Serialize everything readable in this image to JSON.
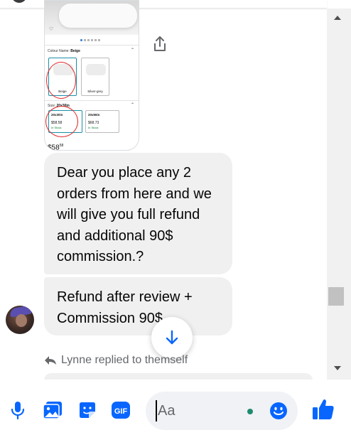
{
  "product_card": {
    "colour_label": "Colour Name:",
    "colour_value": "Beige",
    "swatches": [
      "Beige",
      "Silver-grey"
    ],
    "size_label": "Size:",
    "size_value": "20x30in",
    "sizes": [
      {
        "name": "20x30in",
        "price": "$58.58",
        "stock": "In Stock"
      },
      {
        "name": "20x56in",
        "price": "$68.73",
        "stock": "In Stock"
      }
    ],
    "big_price": "$58",
    "big_price_cents": "58"
  },
  "messages": [
    {
      "text": "Dear you place any 2 orders from here and we will give you full refund and additional 90$ commission.?"
    },
    {
      "text": "Refund after review + Commission 90$"
    }
  ],
  "reply_note": "Lynne replied to themself",
  "composer": {
    "placeholder": "Aa"
  },
  "colors": {
    "accent": "#0866ff",
    "bubble": "#f0f0f0",
    "annotation_red": "#e02a2a"
  },
  "icons": [
    "share-icon",
    "microphone-icon",
    "photo-icon",
    "sticker-icon",
    "gif-icon",
    "emoji-icon",
    "thumbs-up-icon",
    "arrow-down-icon",
    "reply-arrow-icon"
  ]
}
